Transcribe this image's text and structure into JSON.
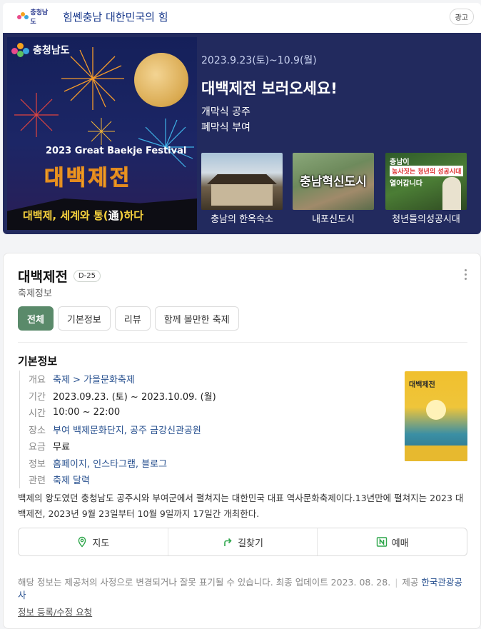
{
  "ad": {
    "logo_text": "충청남도",
    "brand_title": "힘쎈충남 대한민국의 힘",
    "ad_badge": "광고",
    "poster_logo_text": "충청남도",
    "poster_subtitle": "2023 Great Baekje Festival",
    "poster_title": "대백제전",
    "poster_slogan_pre": "대백제, 세계와 통(",
    "poster_slogan_han": "通",
    "poster_slogan_post": ")하다",
    "date_range": "2023.9.23(토)~10.9(월)",
    "headline": "대백제전 보러오세요!",
    "line1": "개막식 공주",
    "line2": "폐막식 부여",
    "thumbnails": [
      {
        "caption": "충남의 한옥숙소"
      },
      {
        "caption": "내포신도시",
        "overlay": "충남혁신도시"
      },
      {
        "caption": "청년들의성공시대",
        "overlay_a": "충남이",
        "overlay_b": "농사짓는 청년의 성공시대",
        "overlay_c": "열어갑니다"
      }
    ]
  },
  "info": {
    "title": "대백제전",
    "dday": "D-25",
    "category": "축제정보",
    "tabs": [
      "전체",
      "기본정보",
      "리뷰",
      "함께 볼만한 축제"
    ],
    "section_title": "기본정보",
    "details": [
      {
        "key": "개요",
        "value": "축제 > 가을문화축제",
        "link": true
      },
      {
        "key": "기간",
        "value": "2023.09.23. (토) ~  2023.10.09. (월)",
        "link": false
      },
      {
        "key": "시간",
        "value": "10:00 ~ 22:00",
        "link": false
      },
      {
        "key": "장소",
        "value": "부여 백제문화단지, 공주 금강신관공원",
        "link": true
      },
      {
        "key": "요금",
        "value": "무료",
        "link": false
      },
      {
        "key": "정보",
        "value": "홈페이지, 인스타그램, 블로그",
        "link": true
      },
      {
        "key": "관련",
        "value": "축제 달력",
        "link": true
      }
    ],
    "poster_thumb_title": "대백제전",
    "description": "백제의 왕도였던 충청남도 공주시와 부여군에서 펼쳐지는 대한민국 대표 역사문화축제이다.13년만에 펼쳐지는 2023 대백제전, 2023년 9월 23일부터 10월 9일까지 17일간 개최한다.",
    "actions": [
      {
        "label": "지도",
        "icon": "map-pin-icon"
      },
      {
        "label": "길찾기",
        "icon": "directions-arrow-icon"
      },
      {
        "label": "예매",
        "icon": "ticket-n-icon"
      }
    ],
    "footer_note": "해당 정보는 제공처의 사정으로 변경되거나 잘못 표기될 수 있습니다. 최종 업데이트 2023. 08. 28.",
    "provider_label": "제공",
    "provider_name": "한국관광공사",
    "edit_link": "정보 등록/수정 요청"
  },
  "colors": {
    "banner_bg": "#222a5e",
    "accent_green": "#5a8a6a",
    "link_blue": "#27508f"
  }
}
